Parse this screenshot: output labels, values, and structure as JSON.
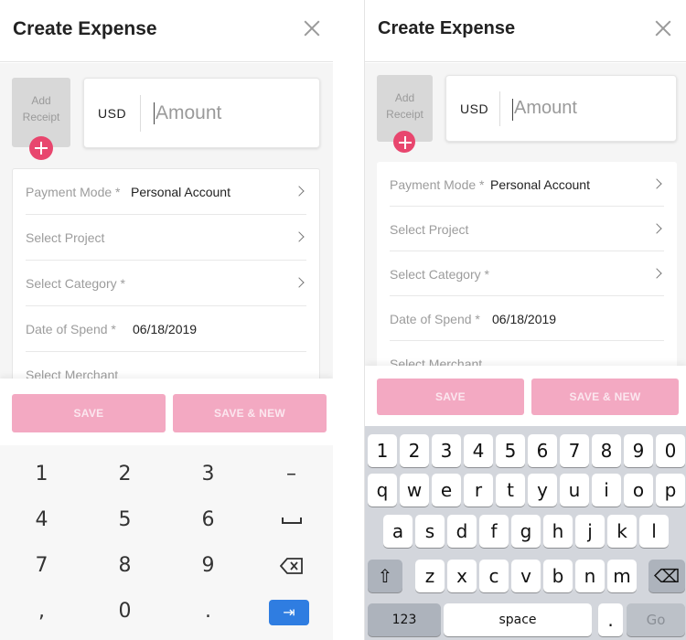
{
  "header": {
    "title": "Create Expense"
  },
  "receipt": {
    "label": "Add Receipt"
  },
  "amount": {
    "currency": "USD",
    "placeholder": "Amount"
  },
  "fields": {
    "payment_mode": {
      "label": "Payment Mode *",
      "value": "Personal Account"
    },
    "project": {
      "label": "Select Project"
    },
    "category": {
      "label": "Select Category *"
    },
    "date": {
      "label": "Date of Spend *",
      "value": "06/18/2019"
    },
    "merchant": {
      "label": "Select Merchant"
    }
  },
  "buttons": {
    "save": "SAVE",
    "save_new": "SAVE & NEW"
  },
  "android_keypad": {
    "rows": [
      [
        "1",
        "2",
        "3",
        "–"
      ],
      [
        "4",
        "5",
        "6",
        "␣"
      ],
      [
        "7",
        "8",
        "9",
        "⌫"
      ],
      [
        ",",
        "0",
        ".",
        "⇥"
      ]
    ]
  },
  "ios_keyboard": {
    "row1": [
      "1",
      "2",
      "3",
      "4",
      "5",
      "6",
      "7",
      "8",
      "9",
      "0"
    ],
    "row2": [
      "q",
      "w",
      "e",
      "r",
      "t",
      "y",
      "u",
      "i",
      "o",
      "p"
    ],
    "row3": [
      "a",
      "s",
      "d",
      "f",
      "g",
      "h",
      "j",
      "k",
      "l"
    ],
    "row4": [
      "z",
      "x",
      "c",
      "v",
      "b",
      "n",
      "m"
    ],
    "shift": "⇧",
    "delete": "⌫",
    "numbers": "123",
    "space": "space",
    "period": ".",
    "go": "Go"
  },
  "colors": {
    "accent": "#e8466e",
    "button_disabled": "#f3a9c2",
    "keypad_action": "#2f7de1"
  }
}
